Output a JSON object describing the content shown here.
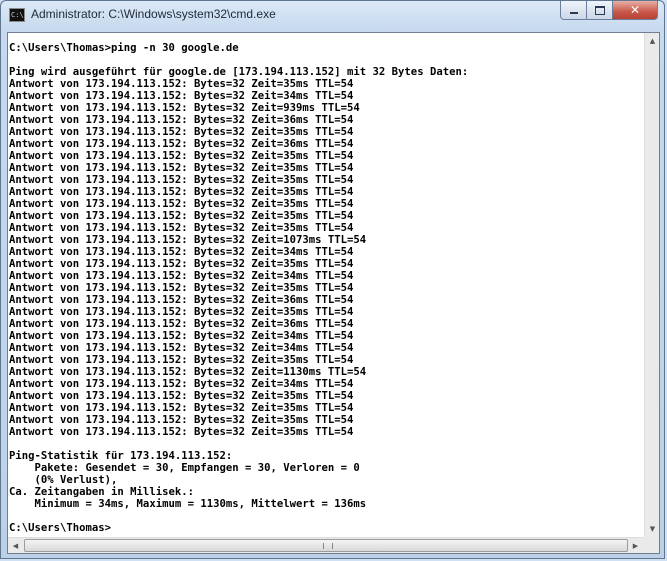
{
  "window": {
    "title": "Administrator: C:\\Windows\\system32\\cmd.exe",
    "icon": "cmd-icon",
    "controls": {
      "minimize": "minimize-icon",
      "maximize": "maximize-icon",
      "close": "close-icon"
    }
  },
  "console": {
    "lines": [
      "C:\\Users\\Thomas>ping -n 30 google.de",
      "",
      "Ping wird ausgeführt für google.de [173.194.113.152] mit 32 Bytes Daten:",
      "Antwort von 173.194.113.152: Bytes=32 Zeit=35ms TTL=54",
      "Antwort von 173.194.113.152: Bytes=32 Zeit=34ms TTL=54",
      "Antwort von 173.194.113.152: Bytes=32 Zeit=939ms TTL=54",
      "Antwort von 173.194.113.152: Bytes=32 Zeit=36ms TTL=54",
      "Antwort von 173.194.113.152: Bytes=32 Zeit=35ms TTL=54",
      "Antwort von 173.194.113.152: Bytes=32 Zeit=36ms TTL=54",
      "Antwort von 173.194.113.152: Bytes=32 Zeit=35ms TTL=54",
      "Antwort von 173.194.113.152: Bytes=32 Zeit=35ms TTL=54",
      "Antwort von 173.194.113.152: Bytes=32 Zeit=35ms TTL=54",
      "Antwort von 173.194.113.152: Bytes=32 Zeit=35ms TTL=54",
      "Antwort von 173.194.113.152: Bytes=32 Zeit=35ms TTL=54",
      "Antwort von 173.194.113.152: Bytes=32 Zeit=35ms TTL=54",
      "Antwort von 173.194.113.152: Bytes=32 Zeit=35ms TTL=54",
      "Antwort von 173.194.113.152: Bytes=32 Zeit=1073ms TTL=54",
      "Antwort von 173.194.113.152: Bytes=32 Zeit=34ms TTL=54",
      "Antwort von 173.194.113.152: Bytes=32 Zeit=35ms TTL=54",
      "Antwort von 173.194.113.152: Bytes=32 Zeit=34ms TTL=54",
      "Antwort von 173.194.113.152: Bytes=32 Zeit=35ms TTL=54",
      "Antwort von 173.194.113.152: Bytes=32 Zeit=36ms TTL=54",
      "Antwort von 173.194.113.152: Bytes=32 Zeit=35ms TTL=54",
      "Antwort von 173.194.113.152: Bytes=32 Zeit=36ms TTL=54",
      "Antwort von 173.194.113.152: Bytes=32 Zeit=34ms TTL=54",
      "Antwort von 173.194.113.152: Bytes=32 Zeit=34ms TTL=54",
      "Antwort von 173.194.113.152: Bytes=32 Zeit=35ms TTL=54",
      "Antwort von 173.194.113.152: Bytes=32 Zeit=1130ms TTL=54",
      "Antwort von 173.194.113.152: Bytes=32 Zeit=34ms TTL=54",
      "Antwort von 173.194.113.152: Bytes=32 Zeit=35ms TTL=54",
      "Antwort von 173.194.113.152: Bytes=32 Zeit=35ms TTL=54",
      "Antwort von 173.194.113.152: Bytes=32 Zeit=35ms TTL=54",
      "Antwort von 173.194.113.152: Bytes=32 Zeit=35ms TTL=54",
      "",
      "Ping-Statistik für 173.194.113.152:",
      "    Pakete: Gesendet = 30, Empfangen = 30, Verloren = 0",
      "    (0% Verlust),",
      "Ca. Zeitangaben in Millisek.:",
      "    Minimum = 34ms, Maximum = 1130ms, Mittelwert = 136ms",
      "",
      "C:\\Users\\Thomas>"
    ]
  },
  "scrollbars": {
    "up": "scroll-up-arrow-icon",
    "down": "scroll-down-arrow-icon",
    "left": "scroll-left-arrow-icon",
    "right": "scroll-right-arrow-icon"
  }
}
